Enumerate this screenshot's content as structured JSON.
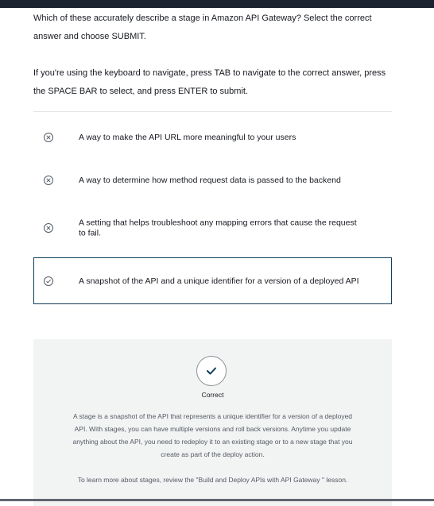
{
  "question": "Which of these accurately describe a stage in Amazon API Gateway? Select the correct answer and choose SUBMIT.",
  "instructions": "If you're using the keyboard to navigate, press TAB to navigate to the correct answer, press the SPACE BAR to select, and press ENTER to submit.",
  "options": [
    {
      "text": "A way to make the API URL more meaningful to your users",
      "state": "incorrect",
      "icon": "x-circle-icon"
    },
    {
      "text": "A way to determine how method request data is passed to the backend",
      "state": "incorrect",
      "icon": "x-circle-icon"
    },
    {
      "text": "A setting that helps troubleshoot any mapping errors that cause the request to fail.",
      "state": "incorrect",
      "icon": "x-circle-icon"
    },
    {
      "text": "A snapshot of the API and a unique identifier for a version of a deployed API",
      "state": "correct",
      "icon": "check-circle-icon"
    }
  ],
  "feedback": {
    "icon": "checkmark-icon",
    "title": "Correct",
    "body": "A stage is a snapshot of the API that represents a unique identifier for a version of a deployed API. With stages, you can have multiple versions and roll back versions. Anytime you update anything about the API, you need to redeploy it to an existing stage or to a new stage that you create as part of the deploy action.",
    "more": "To learn more about stages, review the \"Build and Deploy APIs with API Gateway \" lesson."
  },
  "colors": {
    "accent": "#0f3d5c",
    "feedback_bg": "#f2f3f3",
    "top_bar": "#1b2330"
  }
}
